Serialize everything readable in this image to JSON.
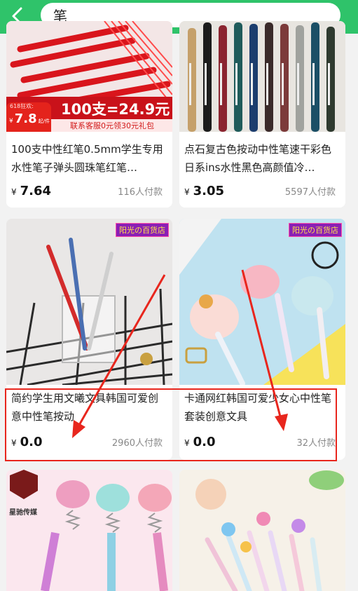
{
  "header": {
    "search_value": "笔"
  },
  "products": [
    {
      "title": "100支中性红笔0.5mm学生专用水性笔子弹头圆珠笔红笔…",
      "price": "7.64",
      "paid": "116人付款",
      "promo": {
        "event": "618狂欢:",
        "price": "7.8",
        "unit": "起/件",
        "banner": "100支=24.9元",
        "service": "联系客服0元领30元礼包"
      }
    },
    {
      "title": "点石复古色按动中性笔速干彩色日系ins水性黑色高颜值冷…",
      "price": "3.05",
      "paid": "5597人付款"
    },
    {
      "title": "简约学生用文曦文具韩国可爱创意中性笔按动",
      "price": "0.0",
      "paid": "2960人付款",
      "shop": "阳光の百货店"
    },
    {
      "title": "卡通网红韩国可爱少女心中性笔套装创意文具",
      "price": "0.0",
      "paid": "32人付款",
      "shop": "阳光の百货店"
    },
    {
      "logo_text": "星驰传媒"
    },
    {}
  ],
  "currency_symbol": "¥",
  "colors": {
    "brand_green": "#2fc36a",
    "annotation_red": "#e8261d"
  }
}
